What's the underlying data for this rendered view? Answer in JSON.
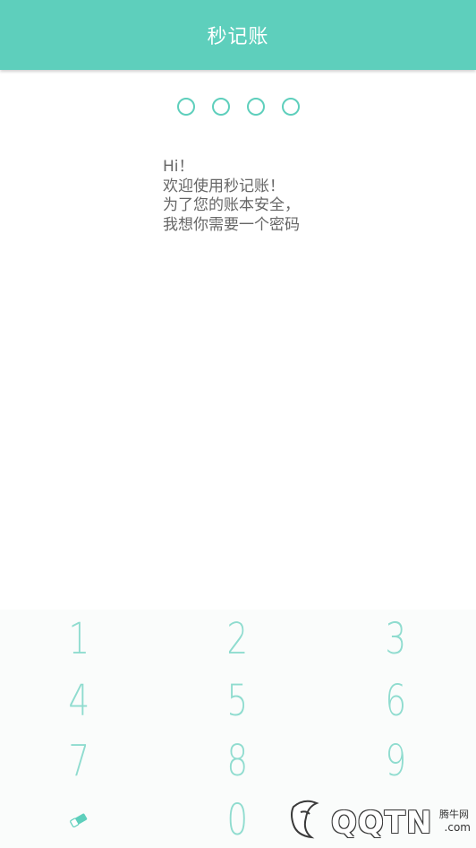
{
  "header": {
    "title": "秒记账"
  },
  "pin": {
    "length": 4,
    "entered": 0
  },
  "message": {
    "lines": [
      "Hi！",
      "欢迎使用秒记账！",
      "为了您的账本安全，",
      "我想你需要一个密码"
    ]
  },
  "keypad": {
    "keys": [
      "1",
      "2",
      "3",
      "4",
      "5",
      "6",
      "7",
      "8",
      "9",
      "0"
    ],
    "delete_icon": "eraser-icon"
  },
  "watermark": {
    "brand": "QQTN",
    "small": "腾牛网",
    "suffix": ".com"
  },
  "colors": {
    "accent": "#5ecfbc",
    "key": "#8fdccf",
    "text": "#666666"
  }
}
